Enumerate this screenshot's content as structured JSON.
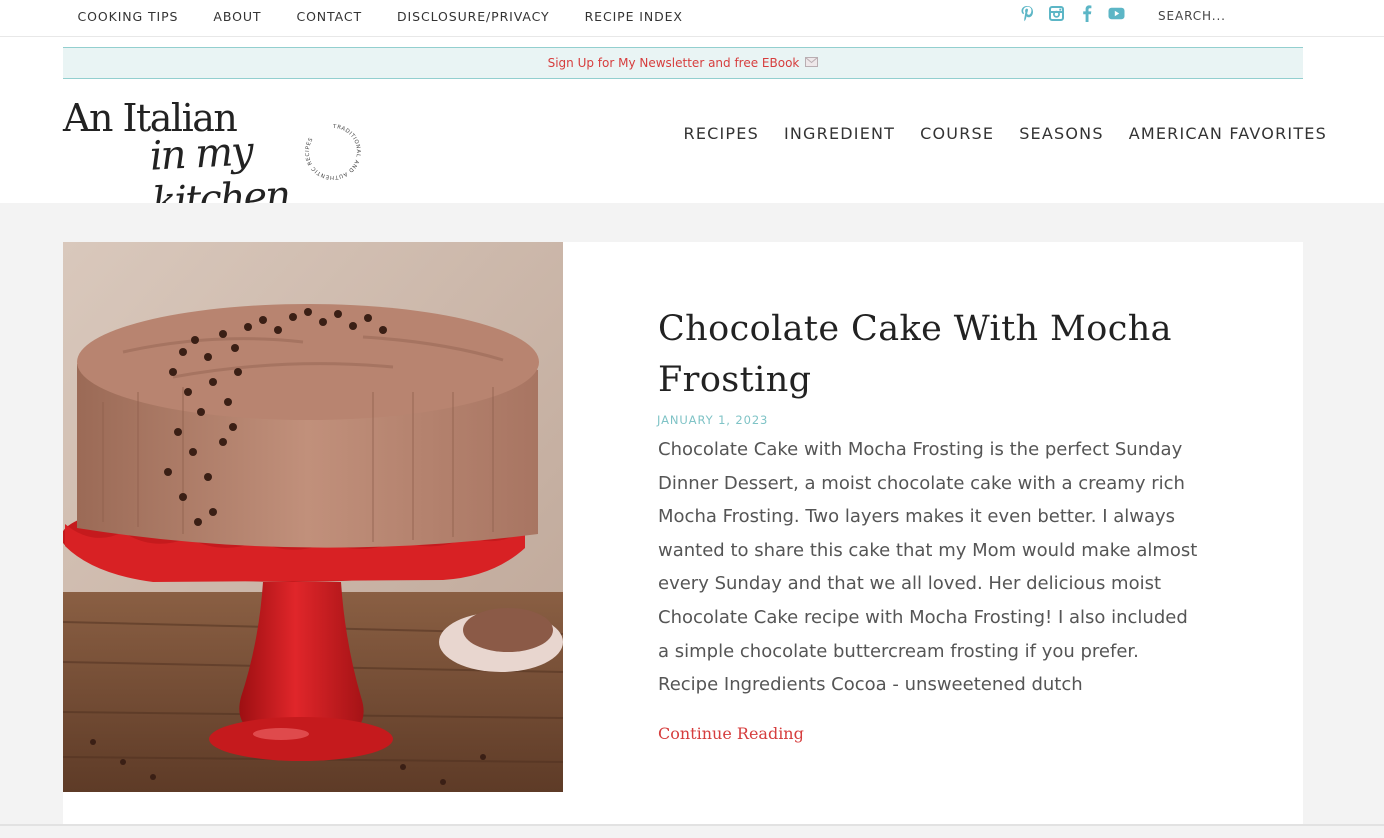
{
  "topnav": {
    "items": [
      "COOKING TIPS",
      "ABOUT",
      "CONTACT",
      "DISCLOSURE/PRIVACY",
      "RECIPE INDEX"
    ]
  },
  "social": {
    "icons": [
      "pinterest-icon",
      "instagram-icon",
      "facebook-icon",
      "youtube-icon"
    ],
    "color": "#5cb6c6"
  },
  "search": {
    "placeholder": "SEARCH..."
  },
  "promo": {
    "text": "Sign Up for My Newsletter and free EBook",
    "color": "#d63d3d",
    "background": "#e9f4f4",
    "border": "#93cfcf"
  },
  "logo": {
    "line1": "An Italian",
    "line2": "in my kitchen",
    "tagline": "TRADITIONAL AND AUTHENTIC RECIPES"
  },
  "mainnav": {
    "items": [
      "RECIPES",
      "INGREDIENT",
      "COURSE",
      "SEASONS",
      "AMERICAN FAVORITES"
    ]
  },
  "post": {
    "title": "Chocolate Cake With Mocha Frosting",
    "date": "JANUARY 1, 2023",
    "excerpt": "Chocolate Cake with Mocha Frosting is the perfect Sunday Dinner Dessert, a moist chocolate cake with a creamy rich Mocha Frosting. Two layers makes it even better. I always wanted to share this cake that my Mom would make almost every Sunday and that we all loved. Her delicious moist Chocolate Cake recipe with Mocha Frosting! I also included a simple chocolate buttercream frosting if you prefer. Recipe Ingredients Cocoa - unsweetened dutch",
    "continue_label": "Continue Reading"
  },
  "colors": {
    "accent": "#d63d3d",
    "teal": "#7fc3c6"
  }
}
